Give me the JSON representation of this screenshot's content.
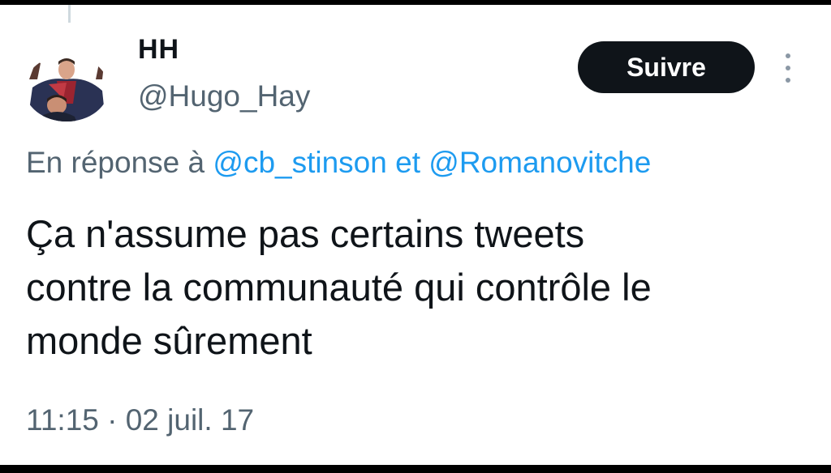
{
  "user": {
    "name": "HH",
    "handle": "@Hugo_Hay"
  },
  "follow_button": {
    "label": "Suivre"
  },
  "reply": {
    "prefix": "En réponse à",
    "mention1": "@cb_stinson",
    "conjunction": "et",
    "mention2": "@Romanovitche"
  },
  "tweet": {
    "lines": [
      "Ça n'assume pas certains tweets",
      "contre la communauté qui contrôle le",
      "monde sûrement"
    ]
  },
  "meta": {
    "timestamp": "11:15 · 02 juil. 17"
  },
  "icons": {
    "more": "more-vertical-icon"
  },
  "colors": {
    "link": "#1d9bf0",
    "button_bg": "#0f1419",
    "secondary_text": "#536471"
  }
}
